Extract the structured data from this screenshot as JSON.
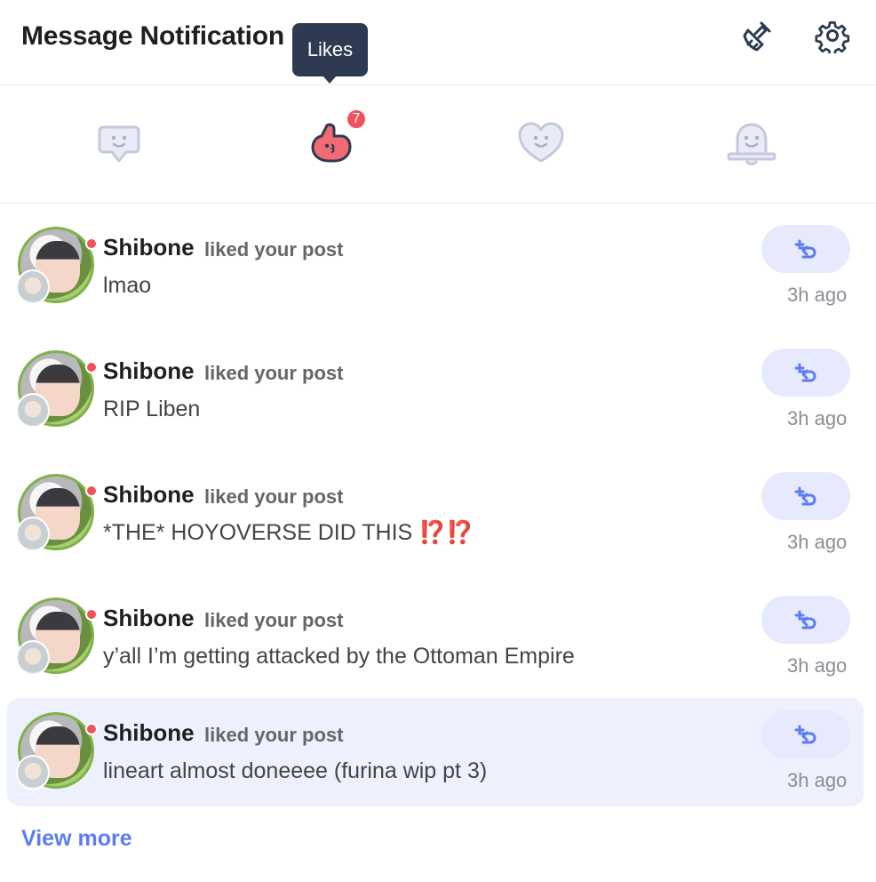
{
  "header": {
    "title": "Message Notification",
    "clear_icon": "broom-icon",
    "settings_icon": "gear-icon"
  },
  "tooltip": {
    "text": "Likes"
  },
  "tabs": [
    {
      "name": "comments",
      "icon": "chat-bubble-smile-icon",
      "active": false
    },
    {
      "name": "likes",
      "icon": "thumbs-up-icon",
      "active": true,
      "badge": "7"
    },
    {
      "name": "follows",
      "icon": "heart-smile-icon",
      "active": false
    },
    {
      "name": "system",
      "icon": "bell-smile-icon",
      "active": false
    }
  ],
  "notifications": [
    {
      "user": "Shibone",
      "action": "liked your post",
      "post": "lmao",
      "time": "3h ago",
      "emoji": ""
    },
    {
      "user": "Shibone",
      "action": "liked your post",
      "post": "RIP Liben",
      "time": "3h ago",
      "emoji": ""
    },
    {
      "user": "Shibone",
      "action": "liked your post",
      "post": "*THE* HOYOVERSE DID THIS",
      "time": "3h ago",
      "emoji": "⁉️⁉️"
    },
    {
      "user": "Shibone",
      "action": "liked your post",
      "post": "y’all I’m getting attacked by the Ottoman Empire",
      "time": "3h ago",
      "emoji": ""
    },
    {
      "user": "Shibone",
      "action": "liked your post",
      "post": "lineart almost doneeee (furina wip pt 3)",
      "time": "3h ago",
      "emoji": ""
    }
  ],
  "footer": {
    "view_more": "View more"
  },
  "colors": {
    "accent": "#5c7cf5",
    "badge": "#f0515a",
    "active_icon": "#f26b74",
    "inactive_icon": "#c3c9dc",
    "highlight": "#eef1fd"
  }
}
